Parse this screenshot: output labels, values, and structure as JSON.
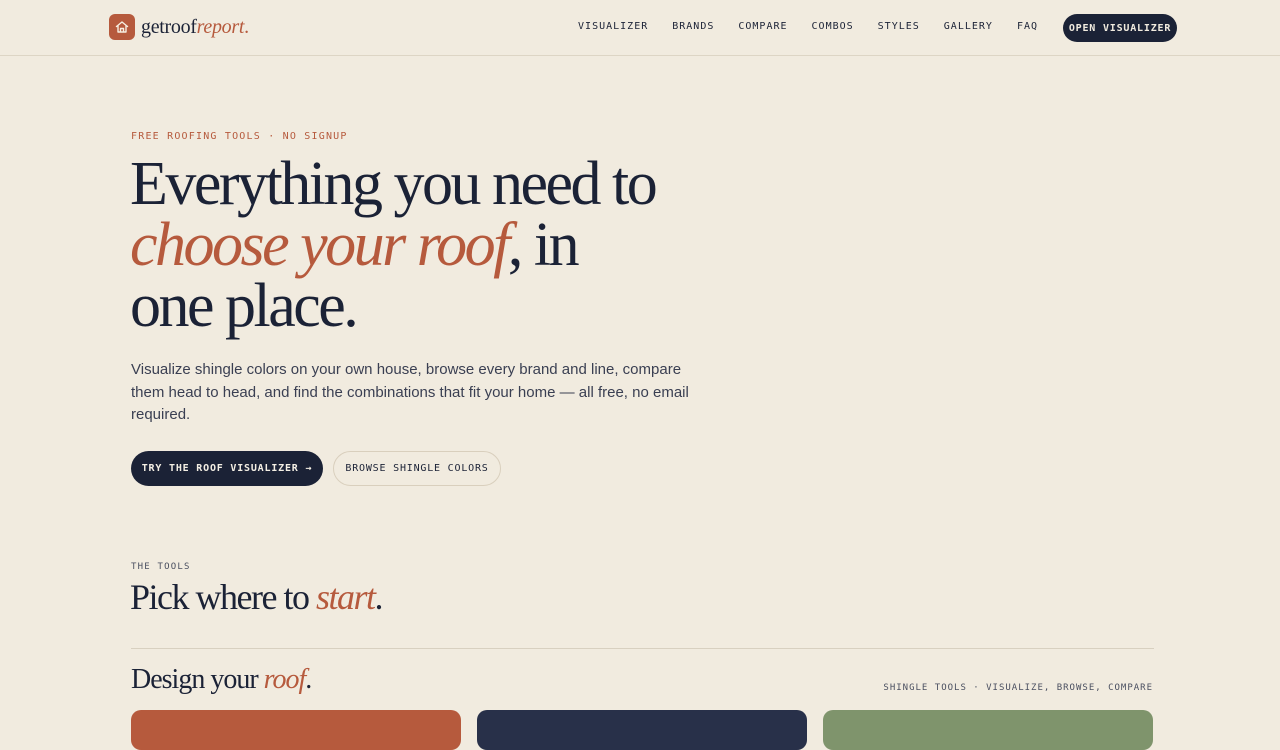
{
  "brand": {
    "logo_main": "getroof",
    "logo_accent": "report",
    "logo_dot": ".",
    "accent_color": "#b65a3d",
    "dark_color": "#1b2236",
    "background_color": "#f1ebdf"
  },
  "nav": {
    "items": [
      {
        "label": "VISUALIZER"
      },
      {
        "label": "BRANDS"
      },
      {
        "label": "COMPARE"
      },
      {
        "label": "COMBOS"
      },
      {
        "label": "STYLES"
      },
      {
        "label": "GALLERY"
      },
      {
        "label": "FAQ"
      }
    ],
    "cta_label": "OPEN VISUALIZER"
  },
  "hero": {
    "eyebrow": "FREE ROOFING TOOLS · NO SIGNUP",
    "title_line1": "Everything you need to",
    "title_accent": "choose your roof",
    "title_after_accent": ", in",
    "title_line3": "one place.",
    "description": "Visualize shingle colors on your own house, browse every brand and line, compare them head to head, and find the combinations that fit your home — all free, no email required.",
    "primary_button": "TRY THE ROOF VISUALIZER →",
    "secondary_button": "BROWSE SHINGLE COLORS"
  },
  "tools": {
    "eyebrow": "THE TOOLS",
    "title_main": "Pick where to ",
    "title_accent": "start",
    "title_end": ".",
    "group": {
      "title_main": "Design your ",
      "title_accent": "roof",
      "title_end": ".",
      "caption": "SHINGLE TOOLS · VISUALIZE, BROWSE, COMPARE",
      "cards": [
        {
          "color": "#b65a3d"
        },
        {
          "color": "#283049"
        },
        {
          "color": "#7f946c"
        }
      ]
    }
  }
}
